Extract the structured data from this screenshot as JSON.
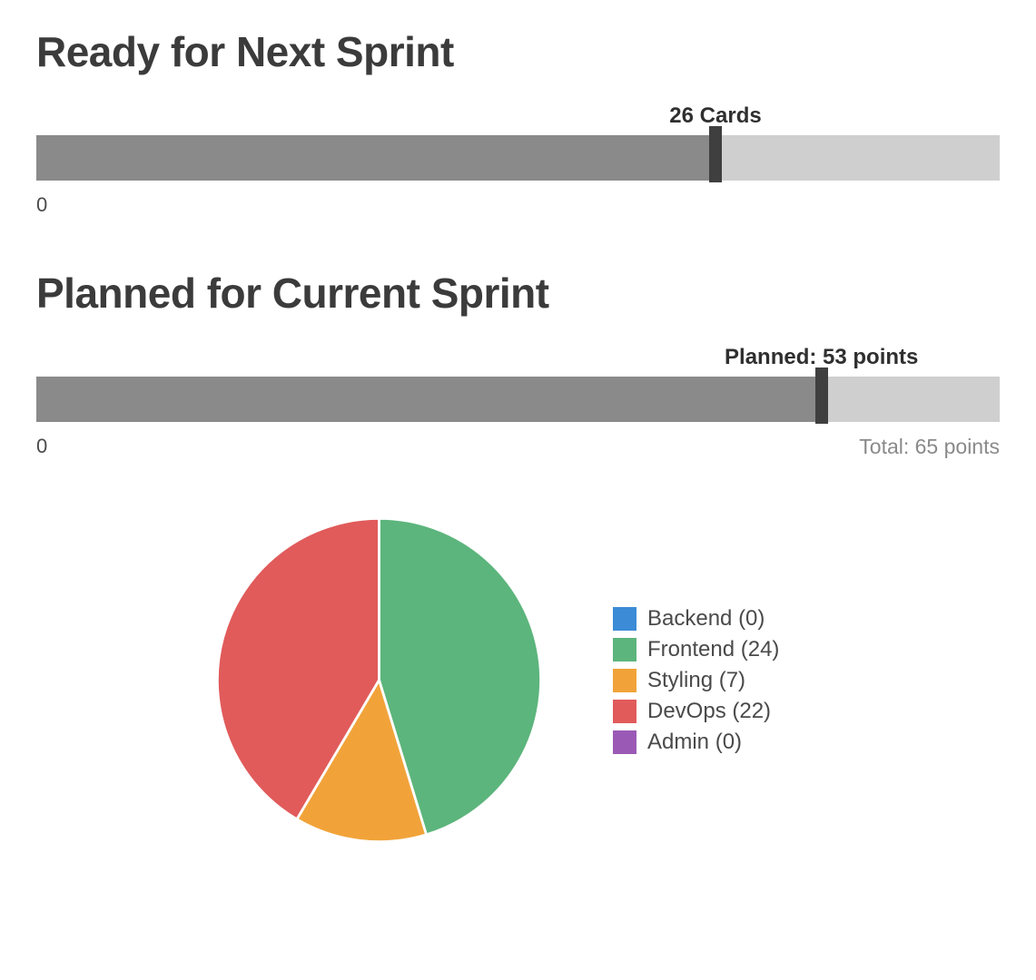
{
  "chart_data": [
    {
      "type": "bar",
      "id": "ready",
      "title": "Ready for Next Sprint",
      "value": 26,
      "max": 36,
      "marker_fraction": 0.705,
      "marker_label": "26 Cards",
      "axis_left": "0",
      "axis_right": ""
    },
    {
      "type": "bar",
      "id": "planned",
      "title": "Planned for Current Sprint",
      "value": 53,
      "max": 65,
      "marker_fraction": 0.815,
      "marker_label": "Planned: 53 points",
      "axis_left": "0",
      "axis_right": "Total: 65 points"
    },
    {
      "type": "pie",
      "id": "pie",
      "series": [
        {
          "name": "Backend",
          "value": 0,
          "color": "#3b8bd6"
        },
        {
          "name": "Frontend",
          "value": 24,
          "color": "#5cb57c"
        },
        {
          "name": "Styling",
          "value": 7,
          "color": "#f1a33a"
        },
        {
          "name": "DevOps",
          "value": 22,
          "color": "#e15b5b"
        },
        {
          "name": "Admin",
          "value": 0,
          "color": "#9b59b6"
        }
      ]
    }
  ]
}
